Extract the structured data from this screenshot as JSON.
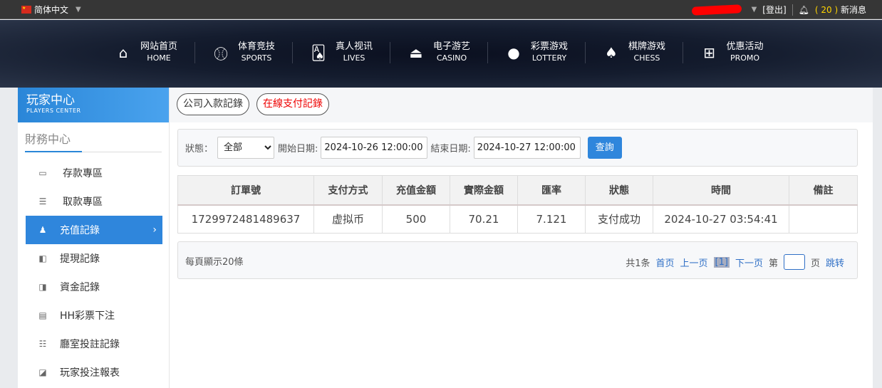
{
  "topbar": {
    "language": "简体中文",
    "logout": "[登出]",
    "message_count": "( 20 )",
    "messages": "新消息"
  },
  "nav": [
    {
      "zh": "网站首页",
      "en": "HOME",
      "icon": "home-icon"
    },
    {
      "zh": "体育竞技",
      "en": "SPORTS",
      "icon": "ball-icon"
    },
    {
      "zh": "真人视讯",
      "en": "LIVES",
      "icon": "cards-icon"
    },
    {
      "zh": "电子游艺",
      "en": "CASINO",
      "icon": "joystick-icon"
    },
    {
      "zh": "彩票游戏",
      "en": "LOTTERY",
      "icon": "lottery-balls-icon"
    },
    {
      "zh": "棋牌游戏",
      "en": "CHESS",
      "icon": "spade-icon"
    },
    {
      "zh": "优惠活动",
      "en": "PROMO",
      "icon": "gift-icon"
    }
  ],
  "sidebar": {
    "title": "玩家中心",
    "subtitle": "PLAYERS CENTER",
    "section": "財務中心",
    "items": [
      {
        "label": "存款專區"
      },
      {
        "label": "取款專區"
      },
      {
        "label": "充值記錄",
        "active": true
      },
      {
        "label": "提現記錄"
      },
      {
        "label": "資金記錄"
      },
      {
        "label": "HH彩票下注"
      },
      {
        "label": "廳室投註記錄"
      },
      {
        "label": "玩家投注報表"
      }
    ]
  },
  "tabs": [
    "公司入款記錄",
    "在線支付記錄"
  ],
  "filter": {
    "status_label": "狀態：",
    "status_value": "全部",
    "start_label": "開始日期:",
    "start_value": "2024-10-26 12:00:00",
    "end_label": "結束日期:",
    "end_value": "2024-10-27 12:00:00",
    "query": "查詢"
  },
  "table": {
    "headers": [
      "訂單號",
      "支付方式",
      "充值金額",
      "實際金額",
      "匯率",
      "狀態",
      "時間",
      "備註"
    ],
    "rows": [
      [
        "1729972481489637",
        "虚拟币",
        "500",
        "70.21",
        "7.121",
        "支付成功",
        "2024-10-27 03:54:41",
        ""
      ]
    ]
  },
  "pager": {
    "per_page": "每頁顯示20條",
    "total": "共1条",
    "first": "首页",
    "prev": "上一页",
    "current": "[1]",
    "next": "下一页",
    "page_pre": "第",
    "page_post": "页",
    "jump": "跳转"
  }
}
